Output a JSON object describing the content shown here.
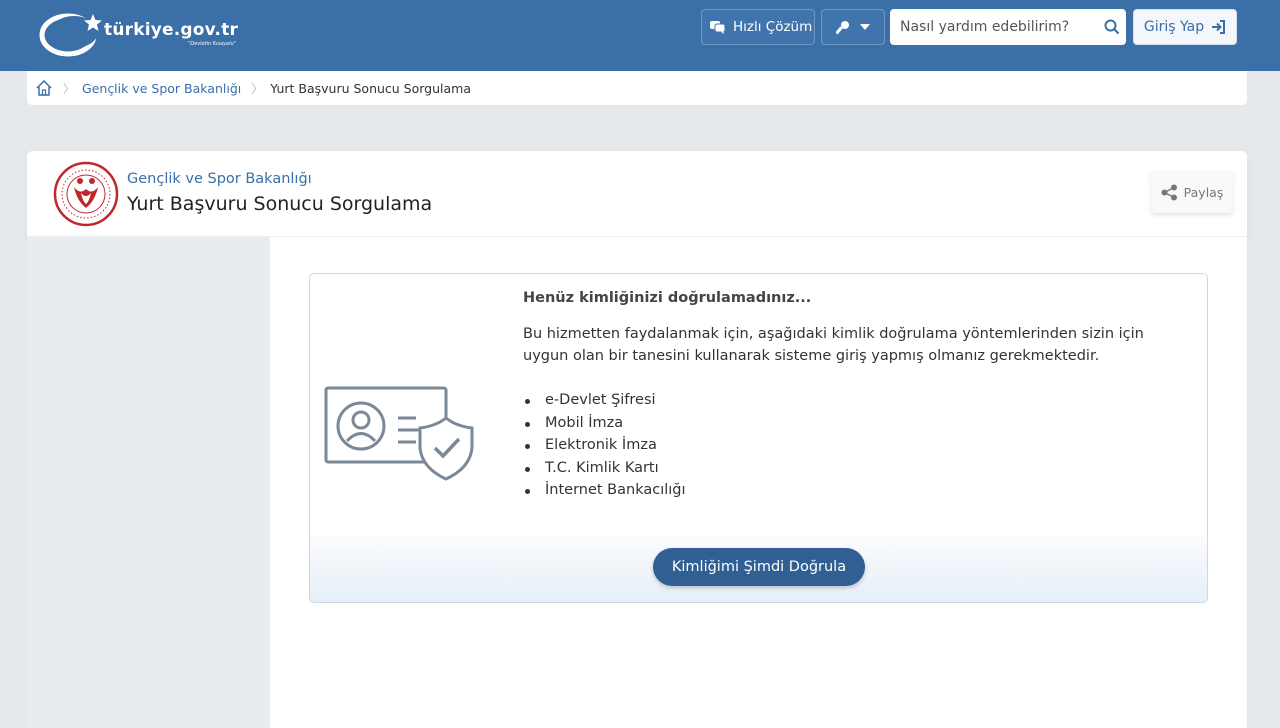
{
  "header": {
    "logo_text": "türkiye.gov.tr",
    "logo_sub": "\"Devletin Kısayolu\"",
    "quick_label": "Hızlı Çözüm",
    "search_placeholder": "Nasıl yardım edebilirim?",
    "login_label": "Giriş Yap"
  },
  "breadcrumb": {
    "items": [
      "Gençlik ve Spor Bakanlığı",
      "Yurt Başvuru Sonucu Sorgulama"
    ]
  },
  "page": {
    "institution": "Gençlik ve Spor Bakanlığı",
    "title": "Yurt Başvuru Sonucu Sorgulama",
    "share_label": "Paylaş"
  },
  "auth": {
    "heading": "Henüz kimliğinizi doğrulamadınız...",
    "description": "Bu hizmetten faydalanmak için, aşağıdaki kimlik doğrulama yöntemlerinden sizin için uygun olan bir tanesini kullanarak sisteme giriş yapmış olmanız gerekmektedir.",
    "methods": [
      "e-Devlet Şifresi",
      "Mobil İmza",
      "Elektronik İmza",
      "T.C. Kimlik Kartı",
      "İnternet Bankacılığı"
    ],
    "button_label": "Kimliğimi Şimdi Doğrula"
  },
  "colors": {
    "header_bg": "#3a6fa8",
    "button_bg": "#2f5f93",
    "emblem_red": "#c0272d"
  }
}
